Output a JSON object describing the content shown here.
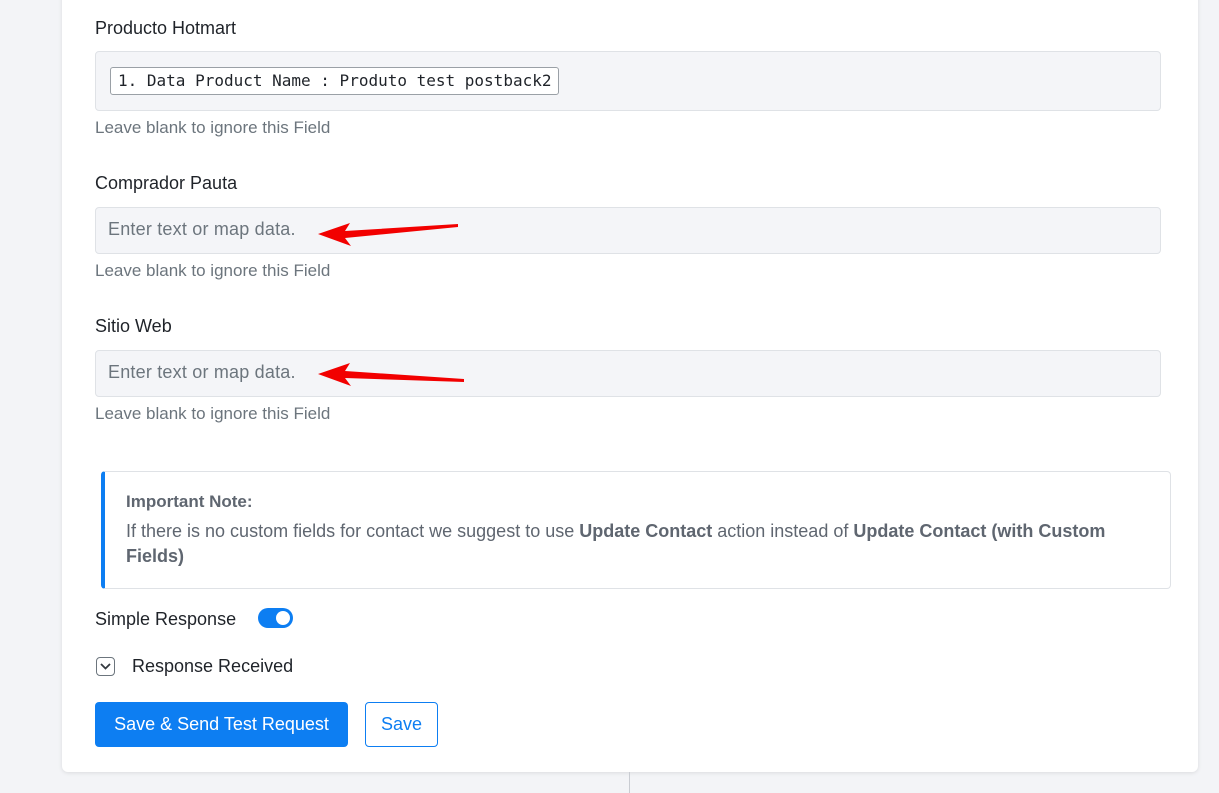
{
  "fields": [
    {
      "label": "Producto Hotmart",
      "mapped_tag": "1. Data Product Name : Produto test postback2",
      "hint": "Leave blank to ignore this Field"
    },
    {
      "label": "Comprador Pauta",
      "placeholder": "Enter text or map data.",
      "hint": "Leave blank to ignore this Field"
    },
    {
      "label": "Sitio Web",
      "placeholder": "Enter text or map data.",
      "hint": "Leave blank to ignore this Field"
    }
  ],
  "note": {
    "title": "Important Note:",
    "text_before": "If there is no custom fields for contact we suggest to use ",
    "bold_1": "Update Contact",
    "text_middle": " action instead of ",
    "bold_2": "Update Contact (with Custom Fields)"
  },
  "simple_response": {
    "label": "Simple Response",
    "enabled": true
  },
  "response_received": {
    "label": "Response Received"
  },
  "buttons": {
    "send_test": "Save & Send Test Request",
    "save": "Save"
  },
  "colors": {
    "accent": "#0d7ef2",
    "annotation_arrow": "#f20000"
  },
  "icons": {
    "toggle": "toggle-switch",
    "expand": "chevron-down-icon",
    "annotation": "red-arrow"
  }
}
